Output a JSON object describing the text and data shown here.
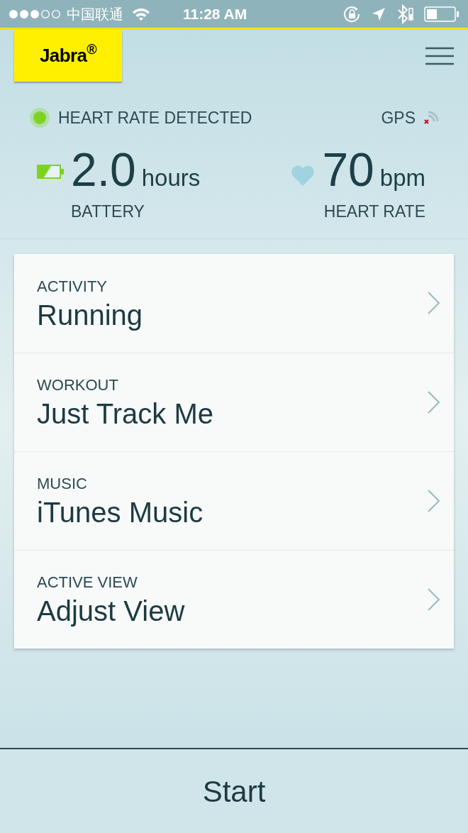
{
  "status_bar": {
    "carrier": "中国联通",
    "time": "11:28 AM"
  },
  "header": {
    "logo": "Jabra$^{®}$"
  },
  "sensors": {
    "heart_rate_status": "HEART RATE DETECTED",
    "heart_rate_detected": true,
    "gps_label": "GPS"
  },
  "stats": [
    {
      "kind": "battery",
      "value": "2.0",
      "unit": "hours",
      "label": "BATTERY"
    },
    {
      "kind": "heart",
      "value": "70",
      "unit": "bpm",
      "label": "HEART RATE"
    }
  ],
  "settings": [
    {
      "label": "ACTIVITY",
      "value": "Running"
    },
    {
      "label": "WORKOUT",
      "value": "Just Track Me"
    },
    {
      "label": "MUSIC",
      "value": "iTunes Music"
    },
    {
      "label": "ACTIVE VIEW",
      "value": "Adjust View"
    }
  ],
  "start_button": "Start"
}
